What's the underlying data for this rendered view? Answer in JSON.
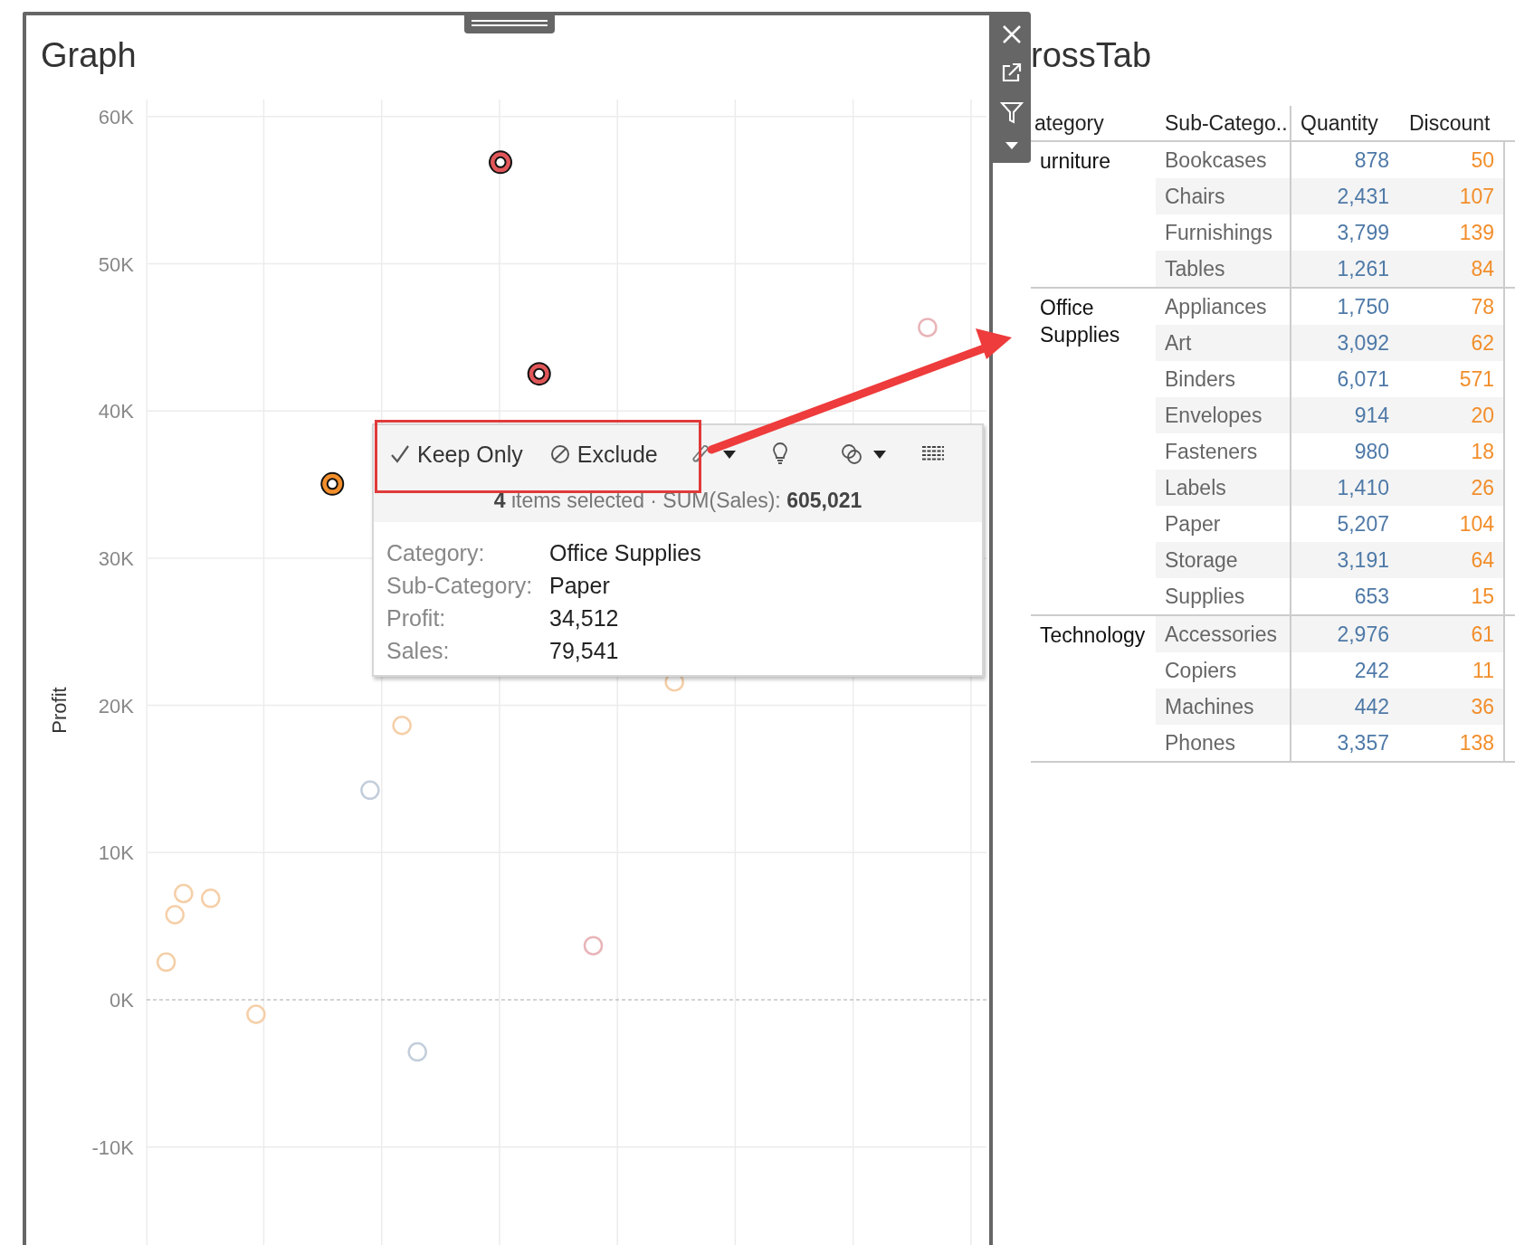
{
  "graph": {
    "title": "Graph",
    "y_axis": {
      "title": "Profit",
      "ticks": [
        "60K",
        "50K",
        "40K",
        "30K",
        "20K",
        "10K",
        "0K",
        "-10K"
      ]
    }
  },
  "tooltip": {
    "actions": [
      {
        "label": "Keep Only",
        "kind": "keep"
      },
      {
        "label": "Exclude",
        "kind": "exclude"
      }
    ],
    "summary": "**4** items selected  ·  SUM(Sales): **605,021**",
    "fields": [
      {
        "label": "Category:",
        "value": "Office Supplies"
      },
      {
        "label": "Sub-Category:",
        "value": "Paper"
      },
      {
        "label": "Profit:",
        "value": "34,512"
      },
      {
        "label": "Sales:",
        "value": "79,541"
      }
    ]
  },
  "crosstab": {
    "title": "rossTab",
    "columns": [
      "ategory",
      "Sub-Catego..",
      "Quantity",
      "Discount"
    ],
    "groups": [
      {
        "category": "urniture",
        "rows": [
          {
            "sub_category": "Bookcases",
            "quantity": "878",
            "discount": "50"
          },
          {
            "sub_category": "Chairs",
            "quantity": "2,431",
            "discount": "107"
          },
          {
            "sub_category": "Furnishings",
            "quantity": "3,799",
            "discount": "139"
          },
          {
            "sub_category": "Tables",
            "quantity": "1,261",
            "discount": "84"
          }
        ]
      },
      {
        "category": "Office Supplies",
        "rows": [
          {
            "sub_category": "Appliances",
            "quantity": "1,750",
            "discount": "78"
          },
          {
            "sub_category": "Art",
            "quantity": "3,092",
            "discount": "62"
          },
          {
            "sub_category": "Binders",
            "quantity": "6,071",
            "discount": "571"
          },
          {
            "sub_category": "Envelopes",
            "quantity": "914",
            "discount": "20"
          },
          {
            "sub_category": "Fasteners",
            "quantity": "980",
            "discount": "18"
          },
          {
            "sub_category": "Labels",
            "quantity": "1,410",
            "discount": "26"
          },
          {
            "sub_category": "Paper",
            "quantity": "5,207",
            "discount": "104"
          },
          {
            "sub_category": "Storage",
            "quantity": "3,191",
            "discount": "64"
          },
          {
            "sub_category": "Supplies",
            "quantity": "653",
            "discount": "15"
          }
        ]
      },
      {
        "category": "Technology",
        "rows": [
          {
            "sub_category": "Accessories",
            "quantity": "2,976",
            "discount": "61"
          },
          {
            "sub_category": "Copiers",
            "quantity": "242",
            "discount": "11"
          },
          {
            "sub_category": "Machines",
            "quantity": "442",
            "discount": "36"
          },
          {
            "sub_category": "Phones",
            "quantity": "3,357",
            "discount": "138"
          }
        ]
      }
    ]
  }
}
